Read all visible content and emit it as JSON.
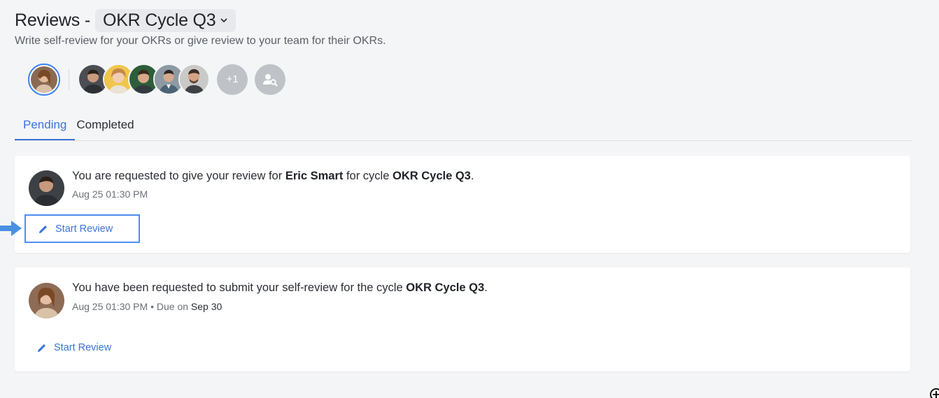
{
  "header": {
    "title": "Reviews -",
    "cycle": "OKR Cycle Q3",
    "subtitle": "Write self-review for your OKRs or give review to your team for their OKRs."
  },
  "team": {
    "more_count": "+1"
  },
  "tabs": [
    {
      "label": "Pending",
      "active": true
    },
    {
      "label": "Completed",
      "active": false
    }
  ],
  "reviews": [
    {
      "text_before": "You are requested to give your review for ",
      "person": "Eric Smart",
      "text_middle": " for cycle ",
      "cycle": "OKR Cycle Q3",
      "text_after": ".",
      "timestamp": "Aug 25 01:30 PM",
      "button_label": "Start Review"
    },
    {
      "text_before": "You have been requested to submit your self-review for the cycle ",
      "cycle": "OKR Cycle Q3",
      "text_after": ".",
      "timestamp": "Aug 25 01:30 PM",
      "separator": " • ",
      "due_label": "Due on ",
      "due_date": "Sep 30",
      "button_label": "Start Review"
    }
  ],
  "colors": {
    "accent": "#3b74d9",
    "highlight_border": "#4c8ef0",
    "background": "#f4f5f7"
  }
}
